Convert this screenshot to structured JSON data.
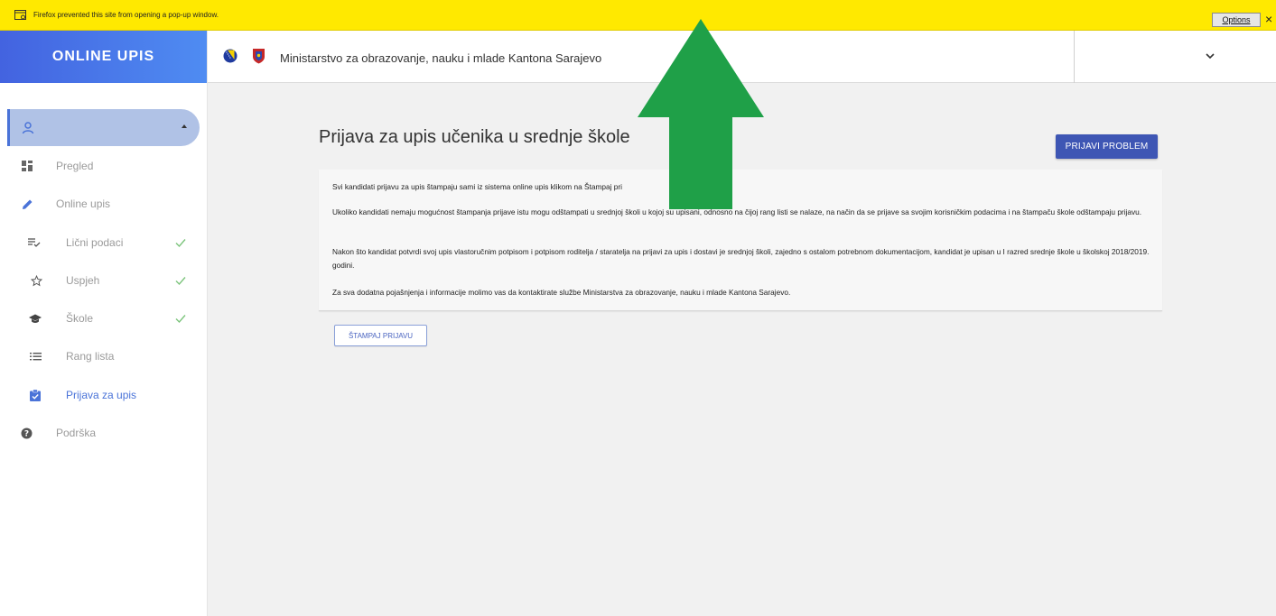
{
  "popup": {
    "message": "Firefox prevented this site from opening a pop-up window.",
    "options_label": "Options",
    "close_label": "×"
  },
  "brand": {
    "name": "ONLINE UPIS"
  },
  "header": {
    "title": "Ministarstvo za obrazovanje, nauku i mlade Kantona Sarajevo"
  },
  "sidebar": {
    "items": [
      {
        "label": "Pregled",
        "icon": "dashboard-icon"
      },
      {
        "label": "Online upis",
        "icon": "pencil-icon"
      },
      {
        "label": "Lični podaci",
        "icon": "list-check-icon",
        "done": true
      },
      {
        "label": "Uspjeh",
        "icon": "star-icon",
        "done": true
      },
      {
        "label": "Škole",
        "icon": "school-icon",
        "done": true
      },
      {
        "label": "Rang lista",
        "icon": "list-icon"
      },
      {
        "label": "Prijava za upis",
        "icon": "clipboard-check-icon",
        "active": true
      },
      {
        "label": "Podrška",
        "icon": "help-icon"
      }
    ]
  },
  "main": {
    "title": "Prijava za upis učenika u srednje škole",
    "report_button": "PRIJAVI PROBLEM",
    "paragraphs": [
      "Svi kandidati prijavu za upis štampaju sami iz sistema online upis klikom na Štampaj pri",
      "Ukoliko kandidati nemaju mogućnost štampanja prijave istu mogu odštampati u srednjoj školi u kojoj su upisani, odnosno na čijoj rang listi se nalaze, na način da se prijave sa svojim korisničkim podacima i na štampaču škole odštampaju prijavu.",
      "Nakon što kandidat potvrdi svoj upis vlastoručnim potpisom i potpisom roditelja / staratelja na prijavi za upis i dostavi je srednjoj školi, zajedno s ostalom potrebnom dokumentacijom, kandidat je upisan u I razred srednje škole u školskoj 2018/2019. godini.",
      "Za sva dodatna pojašnjenja i informacije molimo vas da kontaktirate službe Ministarstva za obrazovanje, nauku i mlade Kantona Sarajevo."
    ],
    "print_button": "ŠTAMPAJ PRIJAVU"
  },
  "colors": {
    "accent": "#4a73d8",
    "popup_bar": "#ffe900",
    "arrow": "#1fa048",
    "check": "#7cc47c"
  }
}
